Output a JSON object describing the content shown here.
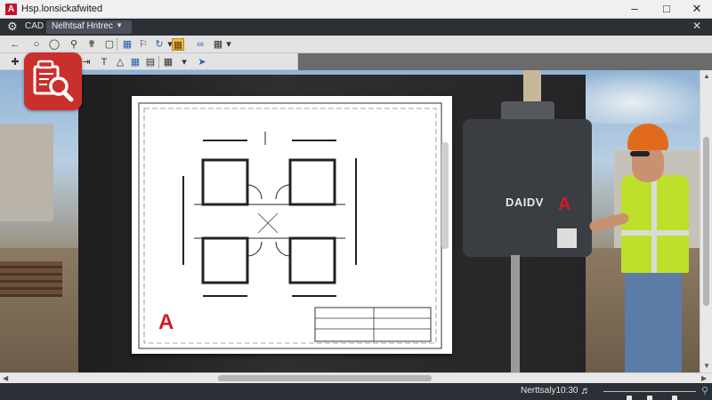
{
  "window": {
    "title": "Hsp.lonsickafwited"
  },
  "menubar": {
    "tab_label": "CAD",
    "doc_tab_label": "Nelhtsaf Hntrec"
  },
  "drawing": {
    "machine_label": "DAIDV"
  },
  "statusbar": {
    "coords": "Nerttsaly10:30"
  },
  "zoom": {
    "positions": [
      0.28,
      0.5,
      0.77
    ]
  },
  "colors": {
    "brand_red": "#c8102e",
    "dark_chrome": "#2b2f36",
    "tool_highlight": "#f0c040"
  },
  "icons": [
    "app-logo-icon",
    "minimize-icon",
    "maximize-icon",
    "close-icon",
    "gear-icon",
    "chevron-down-icon",
    "undo-icon",
    "select-icon",
    "zoom-icon",
    "pan-icon",
    "layer-icon",
    "properties-icon",
    "orbit-icon",
    "layer-state-icon",
    "print-icon",
    "link-icon",
    "grid-icon",
    "snap-icon",
    "magnifier-icon"
  ]
}
